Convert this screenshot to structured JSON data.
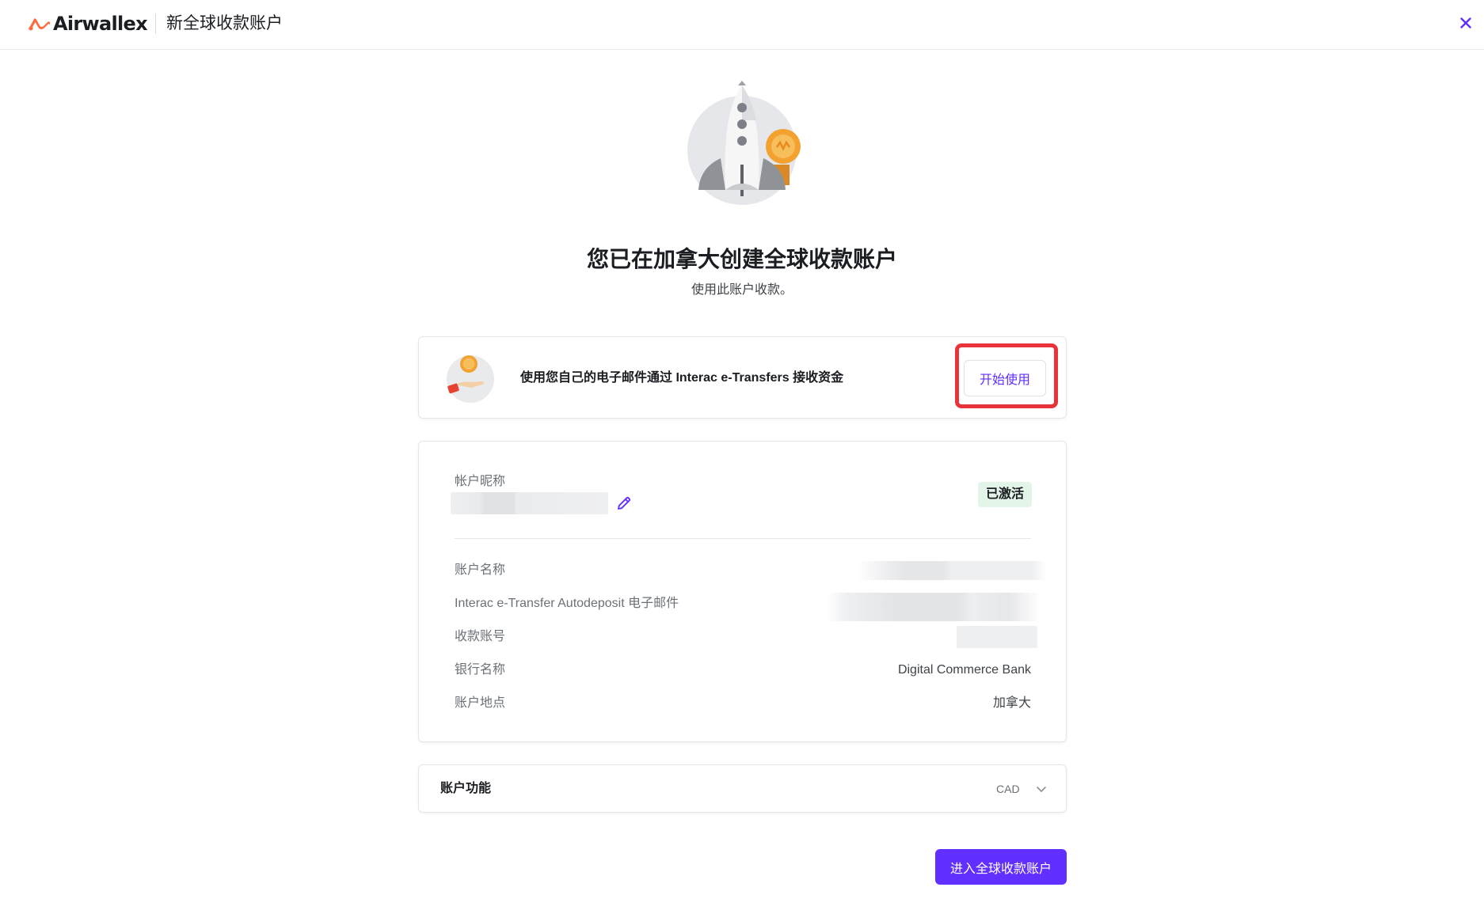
{
  "header": {
    "brand": "Airwallex",
    "title": "新全球收款账户",
    "close_icon": "close-icon",
    "accent_color": "#612fff",
    "brand_color": "#ff6a3d"
  },
  "hero": {
    "illustration": "rocket-illustration",
    "headline": "您已在加拿大创建全球收款账户",
    "subline": "使用此账户收款。"
  },
  "promo": {
    "illustration": "coin-hand-illustration",
    "text": "使用您自己的电子邮件通过 Interac e-Transfers 接收资金",
    "button_label": "开始使用"
  },
  "account": {
    "nickname_label": "帐户昵称",
    "edit_icon": "pencil-icon",
    "status": "已激活",
    "status_color": "#e3f5e8",
    "rows": [
      {
        "label": "账户名称",
        "value": ""
      },
      {
        "label": "Interac e-Transfer Autodeposit 电子邮件",
        "value": ""
      },
      {
        "label": "收款账号",
        "value": ""
      },
      {
        "label": "银行名称",
        "value": "Digital Commerce Bank"
      },
      {
        "label": "账户地点",
        "value": "加拿大"
      }
    ]
  },
  "features": {
    "title": "账户功能",
    "currency": "CAD",
    "chevron_icon": "chevron-down-icon"
  },
  "footer": {
    "primary_button": "进入全球收款账户"
  }
}
